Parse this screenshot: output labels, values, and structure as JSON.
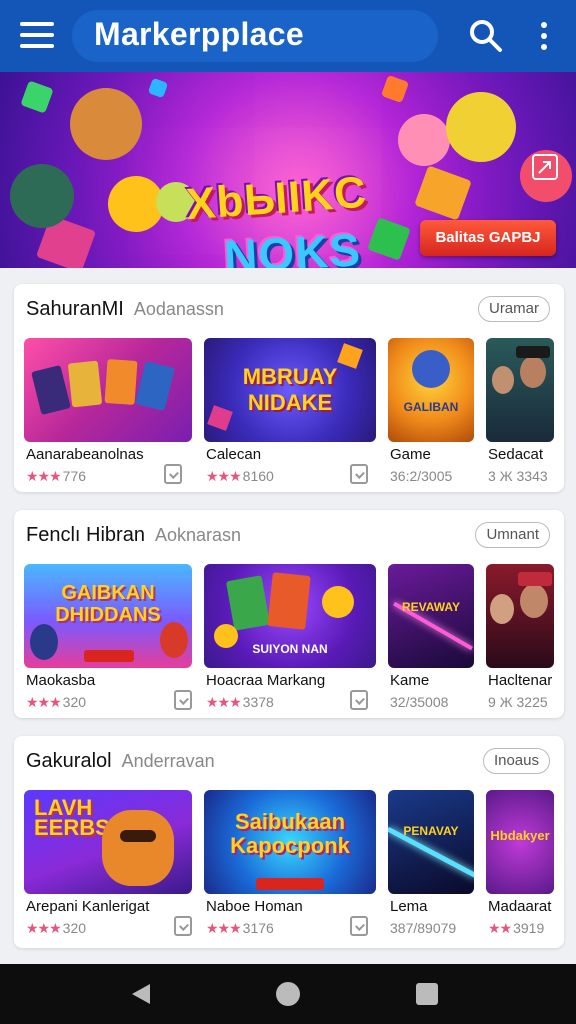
{
  "appbar": {
    "title": "Markerpplace",
    "icons": {
      "menu": "hamburger-menu-icon",
      "search": "search-icon",
      "more": "more-vert-icon"
    }
  },
  "banner": {
    "logo_line1": "XbЫIKC",
    "logo_line2": "NOKS",
    "cta_label": "Balitas GAPBJ",
    "icons": {
      "expand": "expand-icon"
    }
  },
  "sections": [
    {
      "title": "SahuranMI",
      "subtitle": "Aodanassn",
      "button": "Uramar",
      "cards": [
        {
          "name": "Aanarabeanolnas",
          "rating": "776",
          "stars": 3
        },
        {
          "name": "Calecan",
          "rating": "8160",
          "stars": 3,
          "thumb_text": "MBRUAY NIDAKE"
        },
        {
          "name": "Game",
          "rating": "36:2/3005",
          "stars": 0,
          "thumb_text": "GALIBAN"
        },
        {
          "name": "Sedacat",
          "rating": "3343",
          "stars": 0,
          "rating_prefix": "3 Ж"
        }
      ]
    },
    {
      "title": "Fenclı Hibran",
      "subtitle": "Aoknarasn",
      "button": "Umnant",
      "cards": [
        {
          "name": "Maokasba",
          "rating": "320",
          "stars": 3,
          "thumb_text": "GAIBKAN DHIDDANS"
        },
        {
          "name": "Hoacraa Markang",
          "rating": "3378",
          "stars": 3,
          "thumb_text": "SUIYON NAN"
        },
        {
          "name": "Kame",
          "rating": "32/35008",
          "stars": 0,
          "thumb_text": "REVAWAY"
        },
        {
          "name": "Hacltenar",
          "rating": "3225",
          "stars": 0,
          "rating_prefix": "9 Ж"
        }
      ]
    },
    {
      "title": "Gakuralol",
      "subtitle": "Anderravan",
      "button": "Inoaus",
      "cards": [
        {
          "name": "Arepani Kanlerigat",
          "rating": "320",
          "stars": 3,
          "thumb_text": "LAVH EERBS"
        },
        {
          "name": "Naboe Homan",
          "rating": "3176",
          "stars": 3,
          "thumb_text": "Saibukaan Kapocponk"
        },
        {
          "name": "Lema",
          "rating": "387/89079",
          "stars": 0,
          "thumb_text": "PENAVAY"
        },
        {
          "name": "Madaarat",
          "rating": "3919",
          "stars": 2,
          "thumb_text": "Hbdakyer"
        }
      ]
    }
  ],
  "navbar": {
    "icons": {
      "back": "back-icon",
      "home": "home-icon",
      "recents": "recents-icon"
    }
  },
  "colors": {
    "appbar": "#1456b8",
    "star": "#e7557e",
    "navbar": "#0d0d0d"
  }
}
